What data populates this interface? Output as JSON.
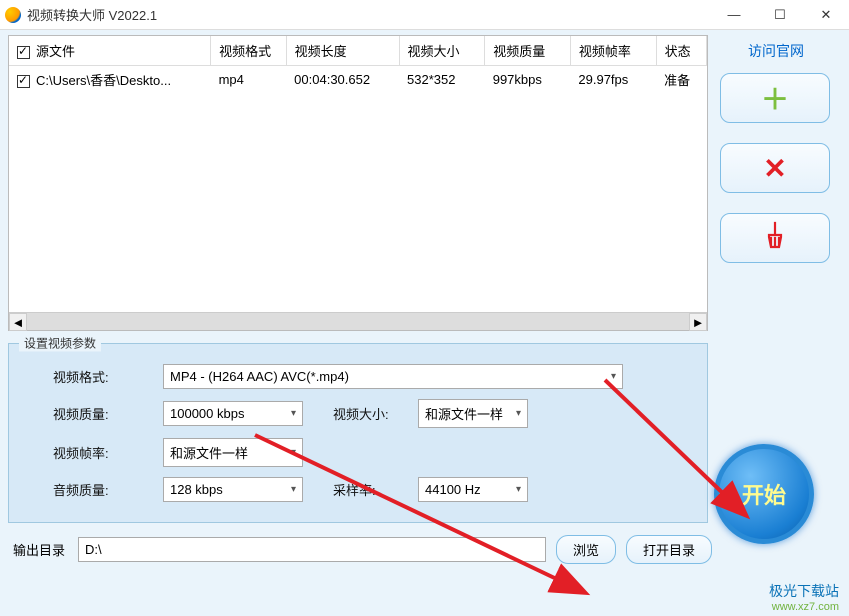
{
  "window": {
    "title": "视频转换大师 V2022.1"
  },
  "official_link": "访问官网",
  "table": {
    "headers": {
      "src": "源文件",
      "fmt": "视频格式",
      "dur": "视频长度",
      "size": "视频大小",
      "quality": "视频质量",
      "fps": "视频帧率",
      "status": "状态"
    },
    "rows": [
      {
        "src": "C:\\Users\\香香\\Deskto...",
        "fmt": "mp4",
        "dur": "00:04:30.652",
        "size": "532*352",
        "quality": "997kbps",
        "fps": "29.97fps",
        "status": "准备"
      }
    ]
  },
  "params": {
    "legend": "设置视频参数",
    "video_format_label": "视频格式:",
    "video_format": "MP4 - (H264 AAC) AVC(*.mp4)",
    "video_quality_label": "视频质量:",
    "video_quality": "100000 kbps",
    "video_size_label": "视频大小:",
    "video_size": "和源文件一样",
    "video_fps_label": "视频帧率:",
    "video_fps": "和源文件一样",
    "audio_quality_label": "音频质量:",
    "audio_quality": "128 kbps",
    "sample_rate_label": "采样率:",
    "sample_rate": "44100 Hz"
  },
  "output": {
    "label": "输出目录",
    "path": "D:\\",
    "browse": "浏览",
    "open": "打开目录"
  },
  "start": "开始",
  "watermark": {
    "line1": "极光下载站",
    "line2": "www.xz7.com"
  }
}
